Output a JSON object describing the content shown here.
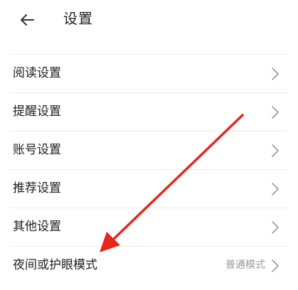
{
  "header": {
    "back_icon": "arrow-left-icon",
    "title": "设置"
  },
  "settings": {
    "items": [
      {
        "label": "阅读设置",
        "value": "",
        "icon": "chevron-right-icon"
      },
      {
        "label": "提醒设置",
        "value": "",
        "icon": "chevron-right-icon"
      },
      {
        "label": "账号设置",
        "value": "",
        "icon": "chevron-right-icon"
      },
      {
        "label": "推荐设置",
        "value": "",
        "icon": "chevron-right-icon"
      },
      {
        "label": "其他设置",
        "value": "",
        "icon": "chevron-right-icon"
      },
      {
        "label": "夜间或护眼模式",
        "value": "普通模式",
        "icon": "chevron-right-icon"
      }
    ]
  },
  "annotation": {
    "icon": "red-arrow-icon",
    "color": "#e8261c"
  },
  "colors": {
    "text": "#1f1f1f",
    "divider": "#ececec",
    "secondary_text": "#9a9a9a",
    "chevron": "#9a9a9a"
  }
}
